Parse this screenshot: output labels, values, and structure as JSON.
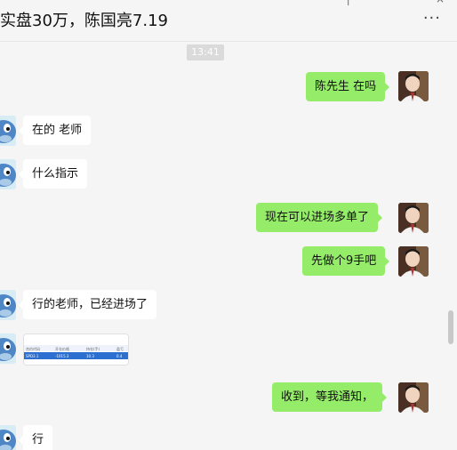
{
  "window": {
    "title": "实盘30万，陈国亮7.19",
    "more_glyph": "···"
  },
  "timestamp": "13:41",
  "messages": [
    {
      "side": "right",
      "text": "陈先生 在吗"
    },
    {
      "side": "left",
      "text": "在的 老师"
    },
    {
      "side": "left",
      "text": "什么指示"
    },
    {
      "side": "right",
      "text": "现在可以进场多单了"
    },
    {
      "side": "right",
      "text": "先做个9手吧"
    },
    {
      "side": "left",
      "text": "行的老师，已经进场了"
    },
    {
      "side": "left",
      "type": "image",
      "image_text": [
        "合约代码",
        "开仓价格",
        "持仓(手)",
        "盈亏",
        "SPD3.1",
        "-1015.3",
        "10.3",
        "0.4"
      ]
    },
    {
      "side": "right",
      "text": "收到，等我通知，"
    },
    {
      "side": "left",
      "text": "行"
    }
  ],
  "colors": {
    "background": "#f5f5f5",
    "my_bubble": "#95ec69",
    "their_bubble": "#ffffff"
  }
}
